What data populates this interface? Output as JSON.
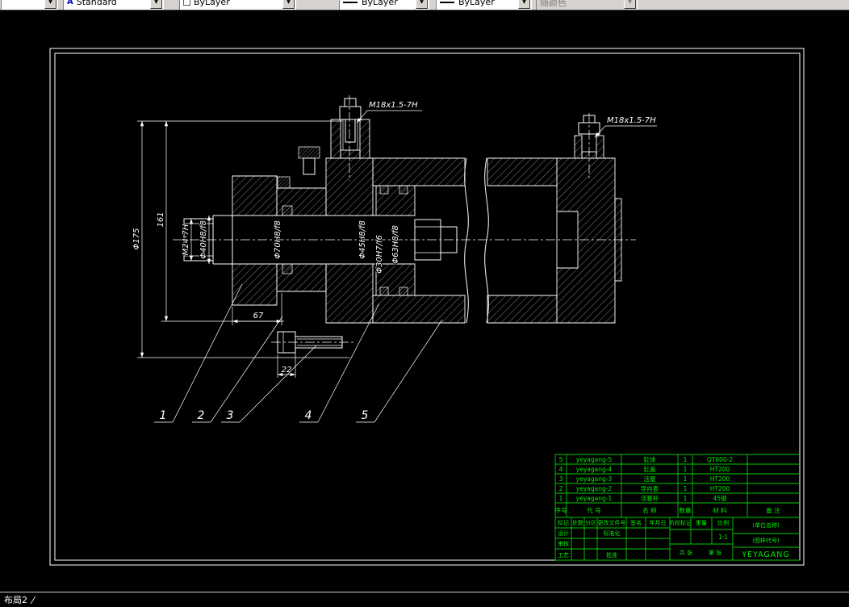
{
  "toolbar": {
    "text_style": "Standard",
    "color": "ByLayer",
    "linetype": "ByLayer",
    "lineweight": "ByLayer",
    "plot_style": "随颜色"
  },
  "statusbar": {
    "layout_tab": "布局2",
    "tab_separator": "/"
  },
  "drawing": {
    "dims": {
      "port_thread_top": "M18x1.5-7H",
      "port_thread_right": "M18x1.5-7H",
      "flange_dia": "Φ175",
      "len_161": "161",
      "rod_thread": "M24-7H",
      "rod_fit": "Φ40H8/f8",
      "gland_fit": "Φ70H8/f8",
      "seal_fit": "Φ45H8/f8",
      "cushion_fit": "Φ30H7/f6",
      "bore_fit": "Φ63H8/f8",
      "len_67": "67",
      "len_22": "22"
    },
    "balloons": [
      "1",
      "2",
      "3",
      "4",
      "5"
    ]
  },
  "title_block": {
    "header": [
      "序号",
      "代 号",
      "名 称",
      "数量",
      "材 料",
      "备 注"
    ],
    "rows": [
      {
        "no": "5",
        "code": "yeyagang-5",
        "name": "缸体",
        "qty": "1",
        "material": "QT600-2"
      },
      {
        "no": "4",
        "code": "yeyagang-4",
        "name": "缸盖",
        "qty": "1",
        "material": "HT200"
      },
      {
        "no": "3",
        "code": "yeyagang-3",
        "name": "活塞",
        "qty": "1",
        "material": "HT200"
      },
      {
        "no": "2",
        "code": "yeyagang-2",
        "name": "导向套",
        "qty": "1",
        "material": "HT200"
      },
      {
        "no": "1",
        "code": "yeyagang-1",
        "name": "活塞杆",
        "qty": "1",
        "material": "45钢"
      }
    ],
    "fields": {
      "mark": "标记",
      "count": "处数",
      "zone": "分区",
      "change_doc": "更改文件号",
      "sign": "签名",
      "date": "年月日",
      "design": "设计",
      "standardize": "标准化",
      "check": "审核",
      "process": "工艺",
      "approve": "批准",
      "stage_mark": "阶段标记",
      "weight": "重量",
      "scale_label": "比例",
      "scale": "1:1",
      "sheets": "共 张",
      "sheet_no": "第 张",
      "company": "(单位名称)",
      "drawing_no": "(图样代号)",
      "product": "YEYAGANG"
    }
  },
  "colors": {
    "background": "#000000",
    "drawing_line": "#ffffff",
    "title_block": "#00cc00",
    "toolbar": "#d6d3ce"
  }
}
